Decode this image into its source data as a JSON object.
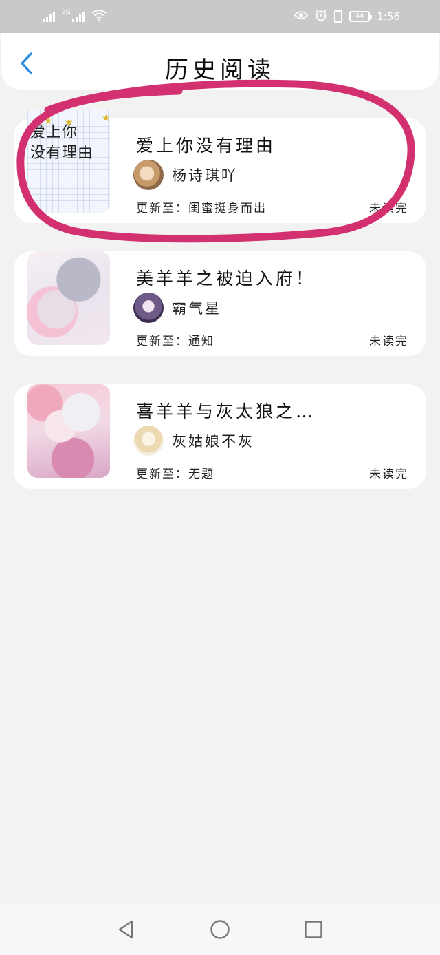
{
  "status_bar": {
    "signal_tag": "2G",
    "battery": "44",
    "time": "1:56"
  },
  "header": {
    "title": "历史阅读"
  },
  "books": [
    {
      "cover_text": "爱上你\n没有理由",
      "title": "爱上你没有理由",
      "author": "杨诗琪吖",
      "update": "更新至：闺蜜挺身而出",
      "status": "未读完"
    },
    {
      "title": "美羊羊之被迫入府！",
      "author": "霸气星",
      "update": "更新至：通知",
      "status": "未读完"
    },
    {
      "title": "喜羊羊与灰太狼之…",
      "author": "灰姑娘不灰",
      "update": "更新至：无题",
      "status": "未读完"
    }
  ],
  "colors": {
    "accent": "#2f8de4",
    "annotation": "#d2306f",
    "background": "#f2f2f2"
  },
  "icons": {
    "back": "chevron-left-icon",
    "nav": [
      "back-triangle-icon",
      "home-circle-icon",
      "recents-square-icon"
    ]
  }
}
